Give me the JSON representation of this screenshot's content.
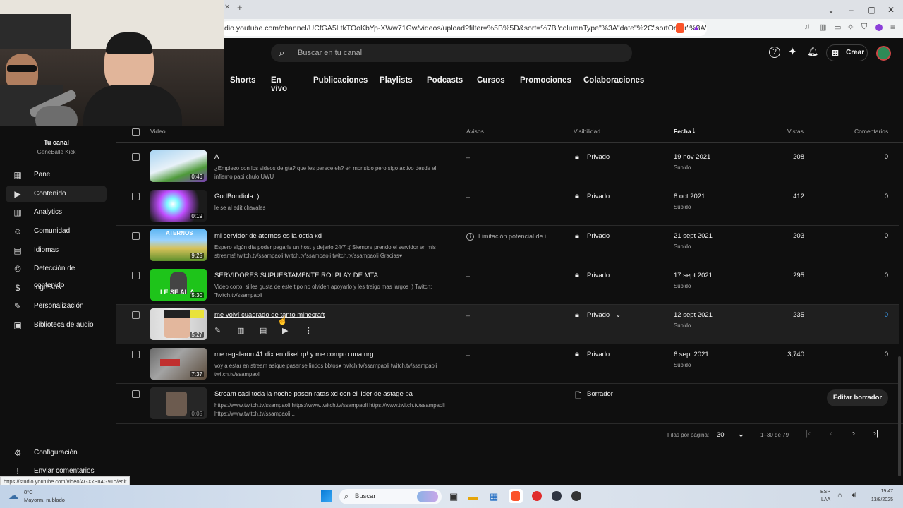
{
  "browser": {
    "url": "dio.youtube.com/channel/UCfGA5LtkTOoKbYp-XWw71Gw/videos/upload?filter=%5B%5D&sort=%7B\"columnType\"%3A\"date\"%2C\"sortOrder\"%3A\"DE...",
    "new_tab": "+",
    "status_url": "https://studio.youtube.com/video/4GXkSu4G91o/edit"
  },
  "header": {
    "search_placeholder": "Buscar en tu canal",
    "create_label": "Crear"
  },
  "tabs": [
    "Shorts",
    "En vivo",
    "Publicaciones",
    "Playlists",
    "Podcasts",
    "Cursos",
    "Promociones",
    "Colaboraciones"
  ],
  "sidebar": {
    "channel_title": "Tu canal",
    "channel_name": "GeneBalle Kick",
    "items": [
      {
        "label": "Panel",
        "icon": "dashboard-icon"
      },
      {
        "label": "Contenido",
        "icon": "content-icon"
      },
      {
        "label": "Analytics",
        "icon": "analytics-icon"
      },
      {
        "label": "Comunidad",
        "icon": "community-icon"
      },
      {
        "label": "Idiomas",
        "icon": "subtitles-icon"
      },
      {
        "label": "Detección de contenido",
        "icon": "copyright-icon"
      },
      {
        "label": "Ingresos",
        "icon": "money-icon"
      },
      {
        "label": "Personalización",
        "icon": "customization-icon"
      },
      {
        "label": "Biblioteca de audio",
        "icon": "audio-library-icon"
      }
    ],
    "settings": "Configuración",
    "feedback": "Enviar comentarios"
  },
  "table": {
    "headers": {
      "video": "Video",
      "avisos": "Avisos",
      "visibilidad": "Visibilidad",
      "fecha": "Fecha",
      "vistas": "Vistas",
      "comentarios": "Comentarios"
    },
    "rows": [
      {
        "title": "A",
        "desc": "¿Empiezo con los videos de gta? que les parece eh? eh morisido pero sigo activo desde el infierno papi chulo UWU",
        "duration": "0:46",
        "avisos": "–",
        "visibility": "Privado",
        "date": "19 nov 2021",
        "status": "Subido",
        "views": "208",
        "comments": "0"
      },
      {
        "title": "GodBondiola :)",
        "desc": "le se al edit chavales",
        "duration": "0:19",
        "avisos": "–",
        "visibility": "Privado",
        "date": "8 oct 2021",
        "status": "Subido",
        "views": "412",
        "comments": "0"
      },
      {
        "title": "mi servidor de aternos es la ostia xd",
        "desc": "Espero algún día poder pagarle un host y dejarlo 24/7 :( Siempre prendo el servidor en mis streams! twitch.tv/ssampaoli twitch.tv/ssampaoli twitch.tv/ssampaoli Gracias♥",
        "duration": "9:25",
        "avisos": "Limitación potencial de i...",
        "visibility": "Privado",
        "date": "21 sept 2021",
        "status": "Subido",
        "views": "203",
        "comments": "0",
        "thumb_text": "ATERNOS"
      },
      {
        "title": "SERVIDORES SUPUESTAMENTE ROLPLAY DE MTA",
        "desc": "Video corto, si les gusta de este tipo no olviden apoyarlo y les traigo mas largos ;) Twitch: Twitch.tv/ssampaoli",
        "duration": "5:30",
        "avisos": "–",
        "visibility": "Privado",
        "date": "17 sept 2021",
        "status": "Subido",
        "views": "295",
        "comments": "0",
        "thumb_text": "LE SE AL A"
      },
      {
        "title": "me volví cuadrado de tanto minecraft",
        "desc": "",
        "duration": "5:27",
        "avisos": "–",
        "visibility": "Privado",
        "date": "12 sept 2021",
        "status": "Subido",
        "views": "235",
        "comments": "0"
      },
      {
        "title": "me regalaron 41 dix en dixel rp! y me compro una nrg",
        "desc": "voy a estar en stream asique pasense lindos bbtos♥ twitch.tv/ssampaoli twitch.tv/ssampaoli twitch.tv/ssampaoli",
        "duration": "7:37",
        "avisos": "–",
        "visibility": "Privado",
        "date": "6 sept 2021",
        "status": "Subido",
        "views": "3,740",
        "comments": "0"
      },
      {
        "title": "Stream casi toda la noche pasen ratas xd con el lider de astage pa",
        "desc": "https://www.twitch.tv/ssampaoli https://www.twitch.tv/ssampaoli https://www.twitch.tv/ssampaoli https://www.twitch.tv/ssampaoli...",
        "duration": "0:05",
        "visibility": "Borrador",
        "edit_draft": "Editar borrador"
      }
    ]
  },
  "pager": {
    "rows_label": "Filas por página:",
    "rows_value": "30",
    "range": "1–30 de 79"
  },
  "taskbar": {
    "search": "Buscar",
    "weather_temp": "8°C",
    "weather_text": "Mayorm. nublado",
    "lang": "ESP",
    "lang2": "LAA",
    "time": "19:47",
    "date": "13/8/2025"
  },
  "colors": {
    "accent": "#3ea6ff",
    "bg": "#0f0f0f"
  }
}
